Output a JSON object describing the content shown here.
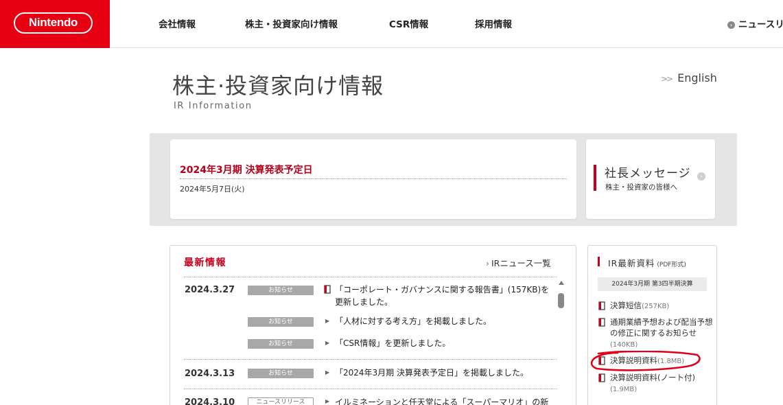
{
  "header": {
    "logo_text": "Nintendo",
    "nav": [
      "会社情報",
      "株主・投資家向け情報",
      "CSR情報",
      "採用情報"
    ],
    "news_link": "ニュースリ"
  },
  "page": {
    "title": "株主·投資家向け情報",
    "subtitle": "IR Information",
    "english_link": "English"
  },
  "schedule": {
    "title": "2024年3月期 決算発表予定日",
    "date": "2024年5月7日(火)"
  },
  "message": {
    "title": "社長メッセージ",
    "subtitle": "株主・投資家の皆様へ"
  },
  "news": {
    "heading": "最新情報",
    "all_link": "IRニュース一覧",
    "items": [
      {
        "date": "2024.3.27",
        "badge": "お知らせ",
        "text": "「コーポレート・ガバナンスに関する報告書」(157KB)を更新しました。"
      },
      {
        "date": "",
        "badge": "お知らせ",
        "text": "「人材に対する考え方」を掲載しました。"
      },
      {
        "date": "",
        "badge": "お知らせ",
        "text": "「CSR情報」を更新しました。"
      },
      {
        "date": "2024.3.13",
        "badge": "お知らせ",
        "text": "「2024年3月期 決算発表予定日」を掲載しました。"
      },
      {
        "date": "2024.3.10",
        "badge": "ニュースリリース",
        "text": "イルミネーションと任天堂による「スーパーマリオ」の新たなアニ"
      }
    ]
  },
  "docs": {
    "heading": "IR最新資料",
    "format": "(PDF形式)",
    "period": "2024年3月期 第3四半期決算",
    "items": [
      {
        "label": "決算短信",
        "size": "(257KB)"
      },
      {
        "label": "通期業績予想および配当予想の修正に関するお知らせ",
        "size": "(140KB)"
      },
      {
        "label": "決算説明資料",
        "size": "(1.8MB)"
      },
      {
        "label": "決算説明資料(ノート付)",
        "size": "(1.9MB)"
      }
    ]
  },
  "colors": {
    "brand_red": "#e60012",
    "accent_red": "#c8001e",
    "annotation_red": "#e0001b"
  }
}
